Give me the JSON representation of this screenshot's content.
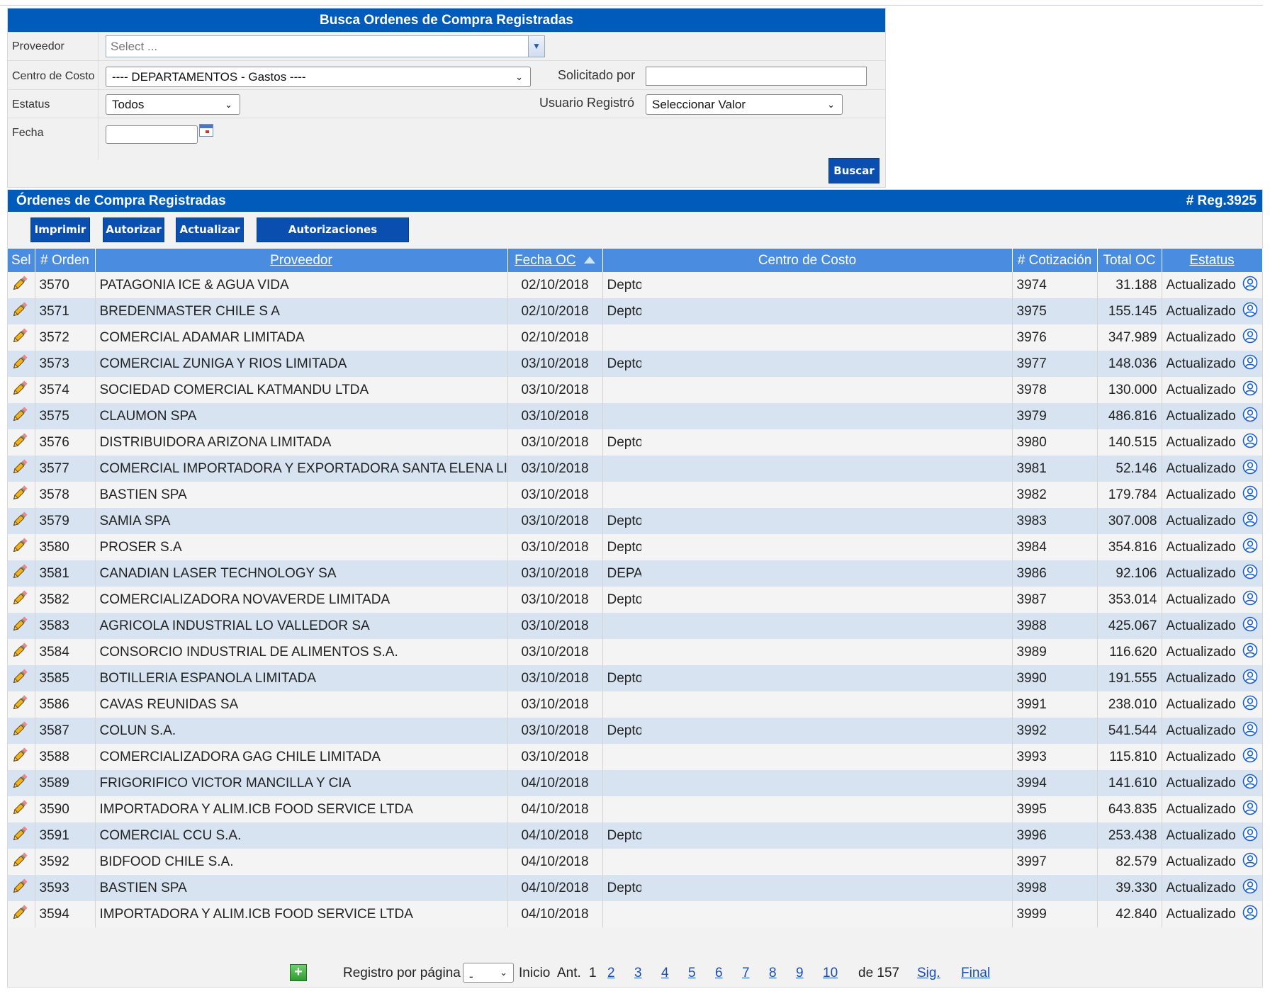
{
  "search": {
    "title": "Busca Ordenes de Compra Registradas",
    "proveedor_label": "Proveedor",
    "proveedor_placeholder": "Select ...",
    "centro_label": "Centro de Costo",
    "centro_value": "---- DEPARTAMENTOS - Gastos ----",
    "solicitado_label": "Solicitado por",
    "solicitado_value": "",
    "estatus_label": "Estatus",
    "estatus_value": "Todos",
    "usuario_label": "Usuario Registró",
    "usuario_value": "Seleccionar Valor",
    "fecha_label": "Fecha",
    "fecha_value": "",
    "buscar_label": "Buscar"
  },
  "results": {
    "title": "Órdenes de Compra Registradas",
    "count": "# Reg.3925",
    "buttons": [
      "Imprimir",
      "Autorizar",
      "Actualizar",
      "Autorizaciones Pendientes"
    ],
    "columns": [
      "Sel",
      "# Orden",
      "Proveedor",
      "Fecha OC",
      "Centro de Costo",
      "# Cotización",
      "Total OC",
      "Estatus"
    ],
    "rows": [
      {
        "orden": "3570",
        "proveedor": "PATAGONIA ICE & AGUA VIDA",
        "fecha": "02/10/2018",
        "centro": "Depto.",
        "cot": "3974",
        "total": "31.188",
        "estatus": "Actualizado"
      },
      {
        "orden": "3571",
        "proveedor": "BREDENMASTER CHILE S A",
        "fecha": "02/10/2018",
        "centro": "Depto.",
        "cot": "3975",
        "total": "155.145",
        "estatus": "Actualizado"
      },
      {
        "orden": "3572",
        "proveedor": "COMERCIAL ADAMAR LIMITADA",
        "fecha": "02/10/2018",
        "centro": "",
        "cot": "3976",
        "total": "347.989",
        "estatus": "Actualizado"
      },
      {
        "orden": "3573",
        "proveedor": "COMERCIAL ZUNIGA Y RIOS LIMITADA",
        "fecha": "03/10/2018",
        "centro": "Depto.",
        "cot": "3977",
        "total": "148.036",
        "estatus": "Actualizado"
      },
      {
        "orden": "3574",
        "proveedor": "SOCIEDAD COMERCIAL KATMANDU LTDA",
        "fecha": "03/10/2018",
        "centro": "",
        "cot": "3978",
        "total": "130.000",
        "estatus": "Actualizado"
      },
      {
        "orden": "3575",
        "proveedor": "CLAUMON SPA",
        "fecha": "03/10/2018",
        "centro": "",
        "cot": "3979",
        "total": "486.816",
        "estatus": "Actualizado"
      },
      {
        "orden": "3576",
        "proveedor": "DISTRIBUIDORA ARIZONA LIMITADA",
        "fecha": "03/10/2018",
        "centro": "Depto.",
        "cot": "3980",
        "total": "140.515",
        "estatus": "Actualizado"
      },
      {
        "orden": "3577",
        "proveedor": "COMERCIAL IMPORTADORA Y EXPORTADORA SANTA ELENA LI",
        "fecha": "03/10/2018",
        "centro": "",
        "cot": "3981",
        "total": "52.146",
        "estatus": "Actualizado"
      },
      {
        "orden": "3578",
        "proveedor": "BASTIEN SPA",
        "fecha": "03/10/2018",
        "centro": "",
        "cot": "3982",
        "total": "179.784",
        "estatus": "Actualizado"
      },
      {
        "orden": "3579",
        "proveedor": "SAMIA SPA",
        "fecha": "03/10/2018",
        "centro": "Depto.",
        "cot": "3983",
        "total": "307.008",
        "estatus": "Actualizado"
      },
      {
        "orden": "3580",
        "proveedor": "PROSER S.A",
        "fecha": "03/10/2018",
        "centro": "Depto.",
        "cot": "3984",
        "total": "354.816",
        "estatus": "Actualizado"
      },
      {
        "orden": "3581",
        "proveedor": "CANADIAN LASER TECHNOLOGY SA",
        "fecha": "03/10/2018",
        "centro": "DEPAF",
        "cot": "3986",
        "total": "92.106",
        "estatus": "Actualizado"
      },
      {
        "orden": "3582",
        "proveedor": "COMERCIALIZADORA NOVAVERDE LIMITADA",
        "fecha": "03/10/2018",
        "centro": "Depto.",
        "cot": "3987",
        "total": "353.014",
        "estatus": "Actualizado"
      },
      {
        "orden": "3583",
        "proveedor": "AGRICOLA INDUSTRIAL LO VALLEDOR SA",
        "fecha": "03/10/2018",
        "centro": "",
        "cot": "3988",
        "total": "425.067",
        "estatus": "Actualizado"
      },
      {
        "orden": "3584",
        "proveedor": "CONSORCIO INDUSTRIAL DE ALIMENTOS S.A.",
        "fecha": "03/10/2018",
        "centro": "",
        "cot": "3989",
        "total": "116.620",
        "estatus": "Actualizado"
      },
      {
        "orden": "3585",
        "proveedor": "BOTILLERIA ESPANOLA LIMITADA",
        "fecha": "03/10/2018",
        "centro": "Depto.",
        "cot": "3990",
        "total": "191.555",
        "estatus": "Actualizado"
      },
      {
        "orden": "3586",
        "proveedor": "CAVAS REUNIDAS SA",
        "fecha": "03/10/2018",
        "centro": "",
        "cot": "3991",
        "total": "238.010",
        "estatus": "Actualizado"
      },
      {
        "orden": "3587",
        "proveedor": "COLUN S.A.",
        "fecha": "03/10/2018",
        "centro": "Depto.",
        "cot": "3992",
        "total": "541.544",
        "estatus": "Actualizado"
      },
      {
        "orden": "3588",
        "proveedor": "COMERCIALIZADORA GAG CHILE LIMITADA",
        "fecha": "03/10/2018",
        "centro": "",
        "cot": "3993",
        "total": "115.810",
        "estatus": "Actualizado"
      },
      {
        "orden": "3589",
        "proveedor": "FRIGORIFICO VICTOR MANCILLA Y CIA",
        "fecha": "04/10/2018",
        "centro": "",
        "cot": "3994",
        "total": "141.610",
        "estatus": "Actualizado"
      },
      {
        "orden": "3590",
        "proveedor": "IMPORTADORA Y ALIM.ICB FOOD SERVICE LTDA",
        "fecha": "04/10/2018",
        "centro": "",
        "cot": "3995",
        "total": "643.835",
        "estatus": "Actualizado"
      },
      {
        "orden": "3591",
        "proveedor": "COMERCIAL CCU S.A.",
        "fecha": "04/10/2018",
        "centro": "Depto.",
        "cot": "3996",
        "total": "253.438",
        "estatus": "Actualizado"
      },
      {
        "orden": "3592",
        "proveedor": "BIDFOOD CHILE S.A.",
        "fecha": "04/10/2018",
        "centro": "",
        "cot": "3997",
        "total": "82.579",
        "estatus": "Actualizado"
      },
      {
        "orden": "3593",
        "proveedor": "BASTIEN SPA",
        "fecha": "04/10/2018",
        "centro": "Depto.",
        "cot": "3998",
        "total": "39.330",
        "estatus": "Actualizado"
      },
      {
        "orden": "3594",
        "proveedor": "IMPORTADORA Y ALIM.ICB FOOD SERVICE LTDA",
        "fecha": "04/10/2018",
        "centro": "",
        "cot": "3999",
        "total": "42.840",
        "estatus": "Actualizado"
      }
    ]
  },
  "pager": {
    "per_page_label": "Registro por página",
    "per_page_value": "-",
    "inicio": "Inicio",
    "ant": "Ant.",
    "current": "1",
    "pages": [
      "2",
      "3",
      "4",
      "5",
      "6",
      "7",
      "8",
      "9",
      "10"
    ],
    "de": "de 157",
    "sig": "Sig.",
    "final": "Final"
  },
  "colors": {
    "header_blue": "#005bbb",
    "col_blue": "#4a8ce0",
    "row_alt": "#d7e3f0",
    "link": "#1a4fb0"
  }
}
